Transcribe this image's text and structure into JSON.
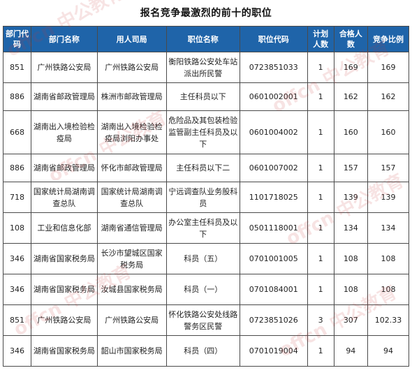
{
  "title": "报名竞争最激烈的前十的职位",
  "watermark": {
    "text": "offcn 中公教育"
  },
  "colors": {
    "header_bg": "#1f64a9",
    "header_text": "#ffffff",
    "border": "#4a4a4a"
  },
  "headers": [
    "部门代码",
    "部门名称",
    "用人司局",
    "职位名称",
    "职位代码",
    "计划人数",
    "合格人数",
    "竞争比例"
  ],
  "rows": [
    [
      "851",
      "广州铁路公安局",
      "广州铁路公安局",
      "衡阳铁路公安处车站派出所民警",
      "0723851033",
      "1",
      "169",
      "169"
    ],
    [
      "886",
      "湖南省邮政管理局",
      "株洲市邮政管理局",
      "主任科员以下",
      "0601002001",
      "1",
      "162",
      "162"
    ],
    [
      "668",
      "湖南出入境检验检疫局",
      "湖南出入境检验检疫局浏阳办事处",
      "危险品及其包装检验监管副主任科员及以下",
      "0601004002",
      "1",
      "160",
      "160"
    ],
    [
      "886",
      "湖南省邮政管理局",
      "怀化市邮政管理局",
      "主任科员以下二",
      "0601007002",
      "1",
      "157",
      "157"
    ],
    [
      "718",
      "国家统计局湖南调查总队",
      "国家统计局湖南调查总队",
      "宁远调查队业务股科员",
      "1101718025",
      "1",
      "139",
      "139"
    ],
    [
      "108",
      "工业和信息化部",
      "湖南省通信管理局",
      "办公室主任科员及以下",
      "0501118001",
      "1",
      "134",
      "134"
    ],
    [
      "346",
      "湖南省国家税务局",
      "长沙市望城区国家税务局",
      "科员（五）",
      "0701001005",
      "1",
      "108",
      "108"
    ],
    [
      "346",
      "湖南省国家税务局",
      "汝城县国家税务局",
      "科员（一）",
      "0701084001",
      "1",
      "108",
      "108"
    ],
    [
      "851",
      "广州铁路公安局",
      "广州铁路公安局",
      "怀化铁路公安处线路警务区民警",
      "0723851026",
      "3",
      "307",
      "102.33"
    ],
    [
      "346",
      "湖南省国家税务局",
      "韶山市国家税务局",
      "科员（四）",
      "0701019004",
      "1",
      "94",
      "94"
    ]
  ]
}
